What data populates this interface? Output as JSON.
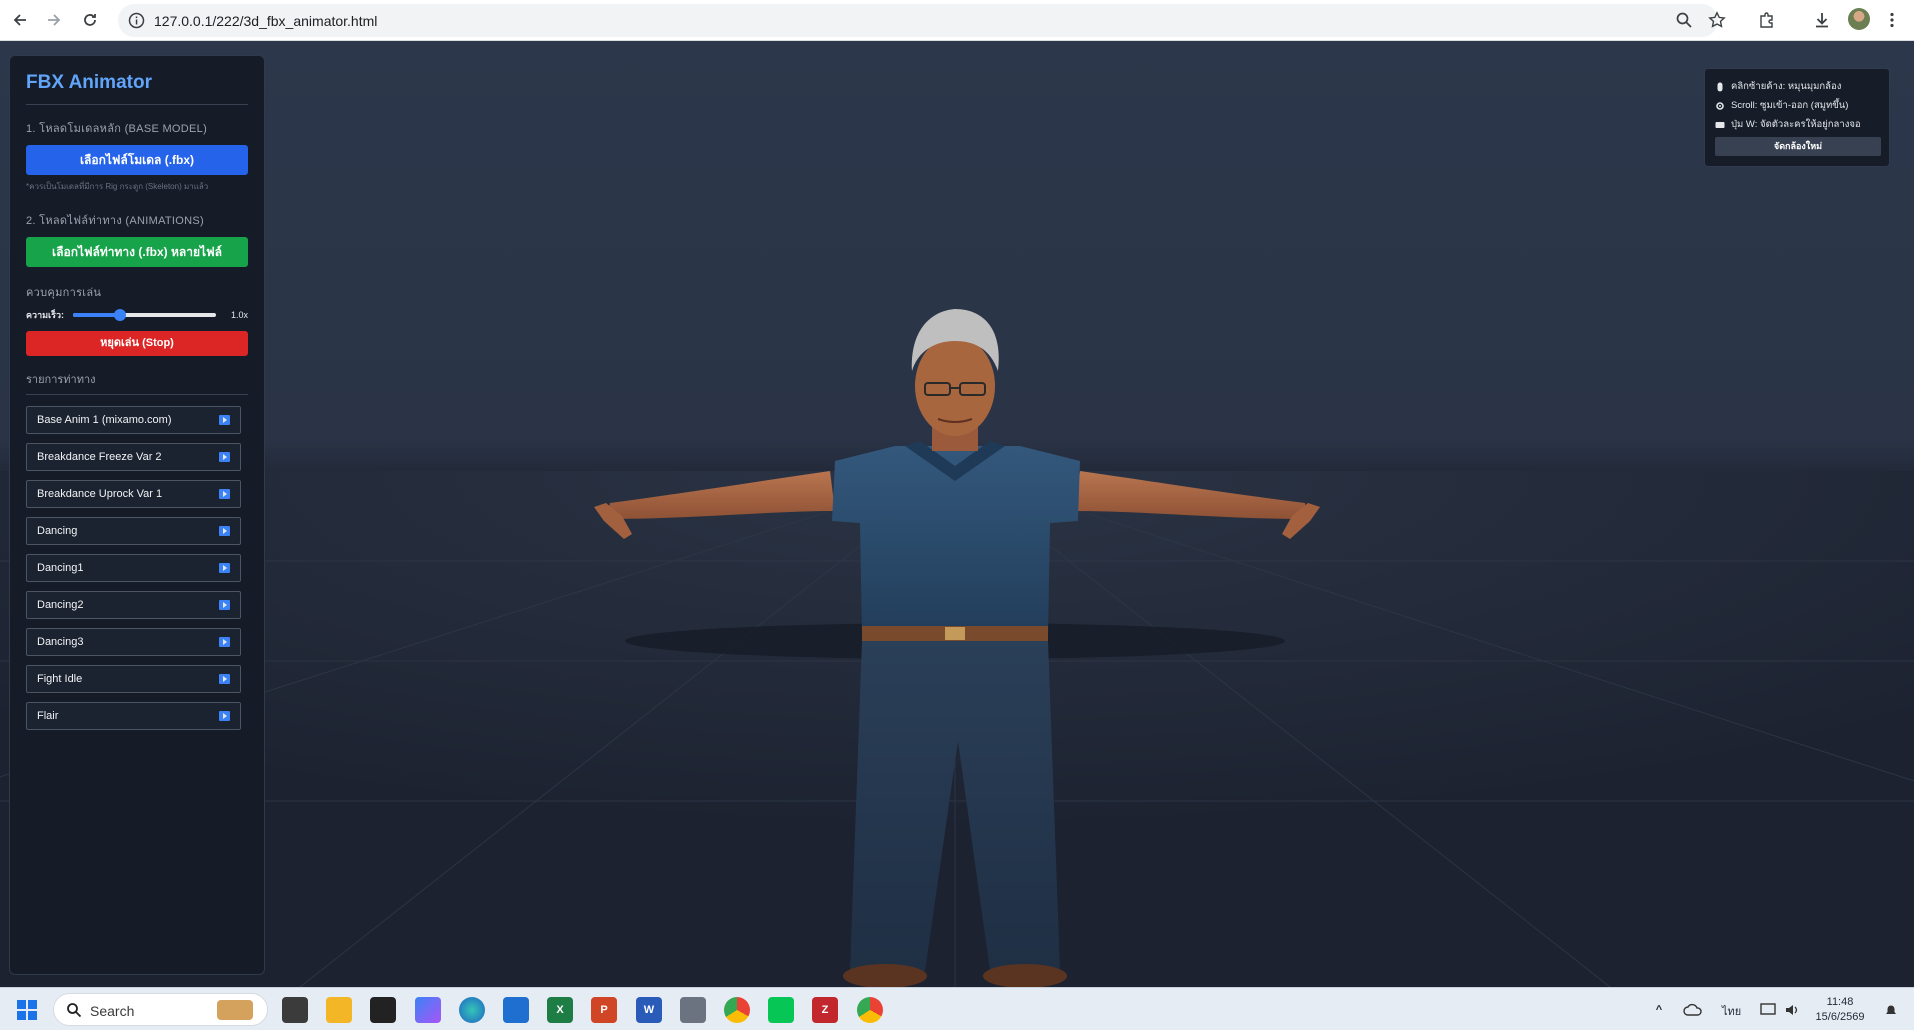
{
  "browser": {
    "url": "127.0.0.1/222/3d_fbx_animator.html"
  },
  "app": {
    "title": "FBX Animator",
    "base_model_label": "1. โหลดโมเดลหลัก (BASE MODEL)",
    "base_model_button": "เลือกไฟล์โมเดล (.fbx)",
    "base_model_hint": "*ควรเป็นโมเดลที่มีการ Rig กระดูก (Skeleton) มาแล้ว",
    "animations_label": "2. โหลดไฟล์ท่าทาง (ANIMATIONS)",
    "animations_button": "เลือกไฟล์ท่าทาง (.fbx) หลายไฟล์",
    "playback_label": "ควบคุมการเล่น",
    "speed_label": "ความเร็ว:",
    "speed_value": "1.0x",
    "speed_fraction": 0.33,
    "stop_button": "หยุดเล่น (Stop)",
    "list_label": "รายการท่าทาง",
    "animations": [
      "Base Anim 1 (mixamo.com)",
      "Breakdance Freeze Var 2",
      "Breakdance Uprock Var 1",
      "Dancing",
      "Dancing1",
      "Dancing2",
      "Dancing3",
      "Fight Idle",
      "Flair"
    ]
  },
  "help": {
    "rotate": "คลิกซ้ายค้าง: หมุนมุมกล้อง",
    "zoom": "Scroll: ซูมเข้า-ออก (สมูทขึ้น)",
    "focus": "ปุ่ม W: จัดตัวละครให้อยู่กลางจอ",
    "reset_button": "จัดกล้องใหม่"
  },
  "taskbar": {
    "search_placeholder": "Search",
    "language": "ไทย",
    "time": "11:48",
    "date": "15/6/2569"
  },
  "colors": {
    "accent": "#60a5fa",
    "blue_button": "#2563eb",
    "green_button": "#16a34a",
    "red_button": "#dc2626"
  }
}
